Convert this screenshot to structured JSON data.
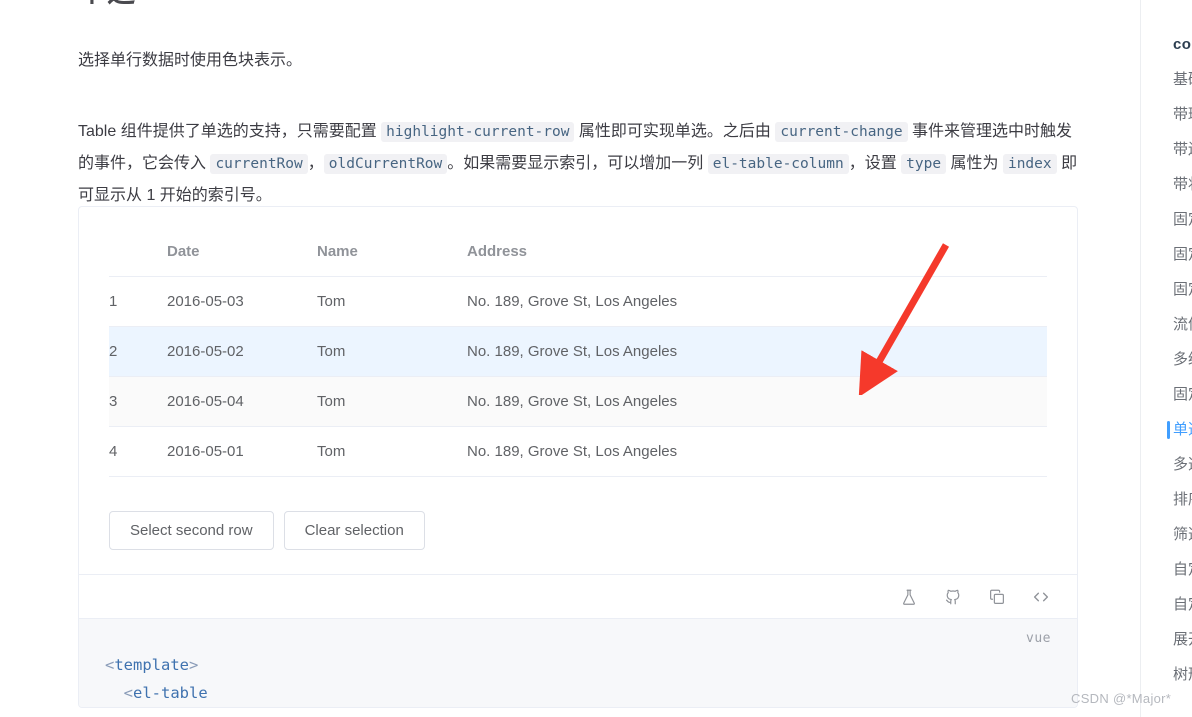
{
  "page": {
    "title": "单选",
    "intro": "选择单行数据时使用色块表示。",
    "watermark": "CSDN @*Major*"
  },
  "description": {
    "seg1": "Table 组件提供了单选的支持，只需要配置 ",
    "code1": "highlight-current-row",
    "seg2": " 属性即可实现单选。之后由 ",
    "code2": "current-change",
    "seg3": " 事件来管理选中时触发的事件，它会传入 ",
    "code3": "currentRow",
    "seg4": "，",
    "code4": "oldCurrentRow",
    "seg5": "。如果需要显示索引，可以增加一列 ",
    "code5": "el-table-column",
    "seg6": "，设置 ",
    "code6": "type",
    "seg7": " 属性为 ",
    "code7": "index",
    "seg8": " 即可显示从 1 开始的索引号。"
  },
  "table": {
    "columns": [
      "",
      "Date",
      "Name",
      "Address"
    ],
    "rows": [
      {
        "index": "1",
        "date": "2016-05-03",
        "name": "Tom",
        "address": "No. 189, Grove St, Los Angeles",
        "state": "normal"
      },
      {
        "index": "2",
        "date": "2016-05-02",
        "name": "Tom",
        "address": "No. 189, Grove St, Los Angeles",
        "state": "highlight"
      },
      {
        "index": "3",
        "date": "2016-05-04",
        "name": "Tom",
        "address": "No. 189, Grove St, Los Angeles",
        "state": "hover"
      },
      {
        "index": "4",
        "date": "2016-05-01",
        "name": "Tom",
        "address": "No. 189, Grove St, Los Angeles",
        "state": "normal"
      }
    ]
  },
  "buttons": {
    "select_second_row": "Select second row",
    "clear_selection": "Clear selection"
  },
  "iconbar": {
    "icons": [
      "flask-icon",
      "github-icon",
      "copy-icon",
      "code-icon"
    ]
  },
  "code": {
    "lang": "vue",
    "line1_open": "<",
    "line1_tag": "template",
    "line1_close": ">",
    "line2_open": "<",
    "line2_tag": "el-table"
  },
  "sidebar": {
    "heading": "co",
    "items": [
      {
        "label": "基础",
        "active": false
      },
      {
        "label": "带斑",
        "active": false
      },
      {
        "label": "带边",
        "active": false
      },
      {
        "label": "带状",
        "active": false
      },
      {
        "label": "固定",
        "active": false
      },
      {
        "label": "固定",
        "active": false
      },
      {
        "label": "固定",
        "active": false
      },
      {
        "label": "流体",
        "active": false
      },
      {
        "label": "多级",
        "active": false
      },
      {
        "label": "固定",
        "active": false
      },
      {
        "label": "单选",
        "active": true
      },
      {
        "label": "多选",
        "active": false
      },
      {
        "label": "排序",
        "active": false
      },
      {
        "label": "筛选",
        "active": false
      },
      {
        "label": "自定",
        "active": false
      },
      {
        "label": "自定",
        "active": false
      },
      {
        "label": "展开",
        "active": false
      },
      {
        "label": "树形",
        "active": false
      }
    ]
  },
  "colors": {
    "accent": "#409eff",
    "row_highlight": "#ecf5ff",
    "row_hover": "#fafafa",
    "border": "#ebeef5",
    "arrow": "#f5392b",
    "code_bg": "#f7f8fa"
  }
}
